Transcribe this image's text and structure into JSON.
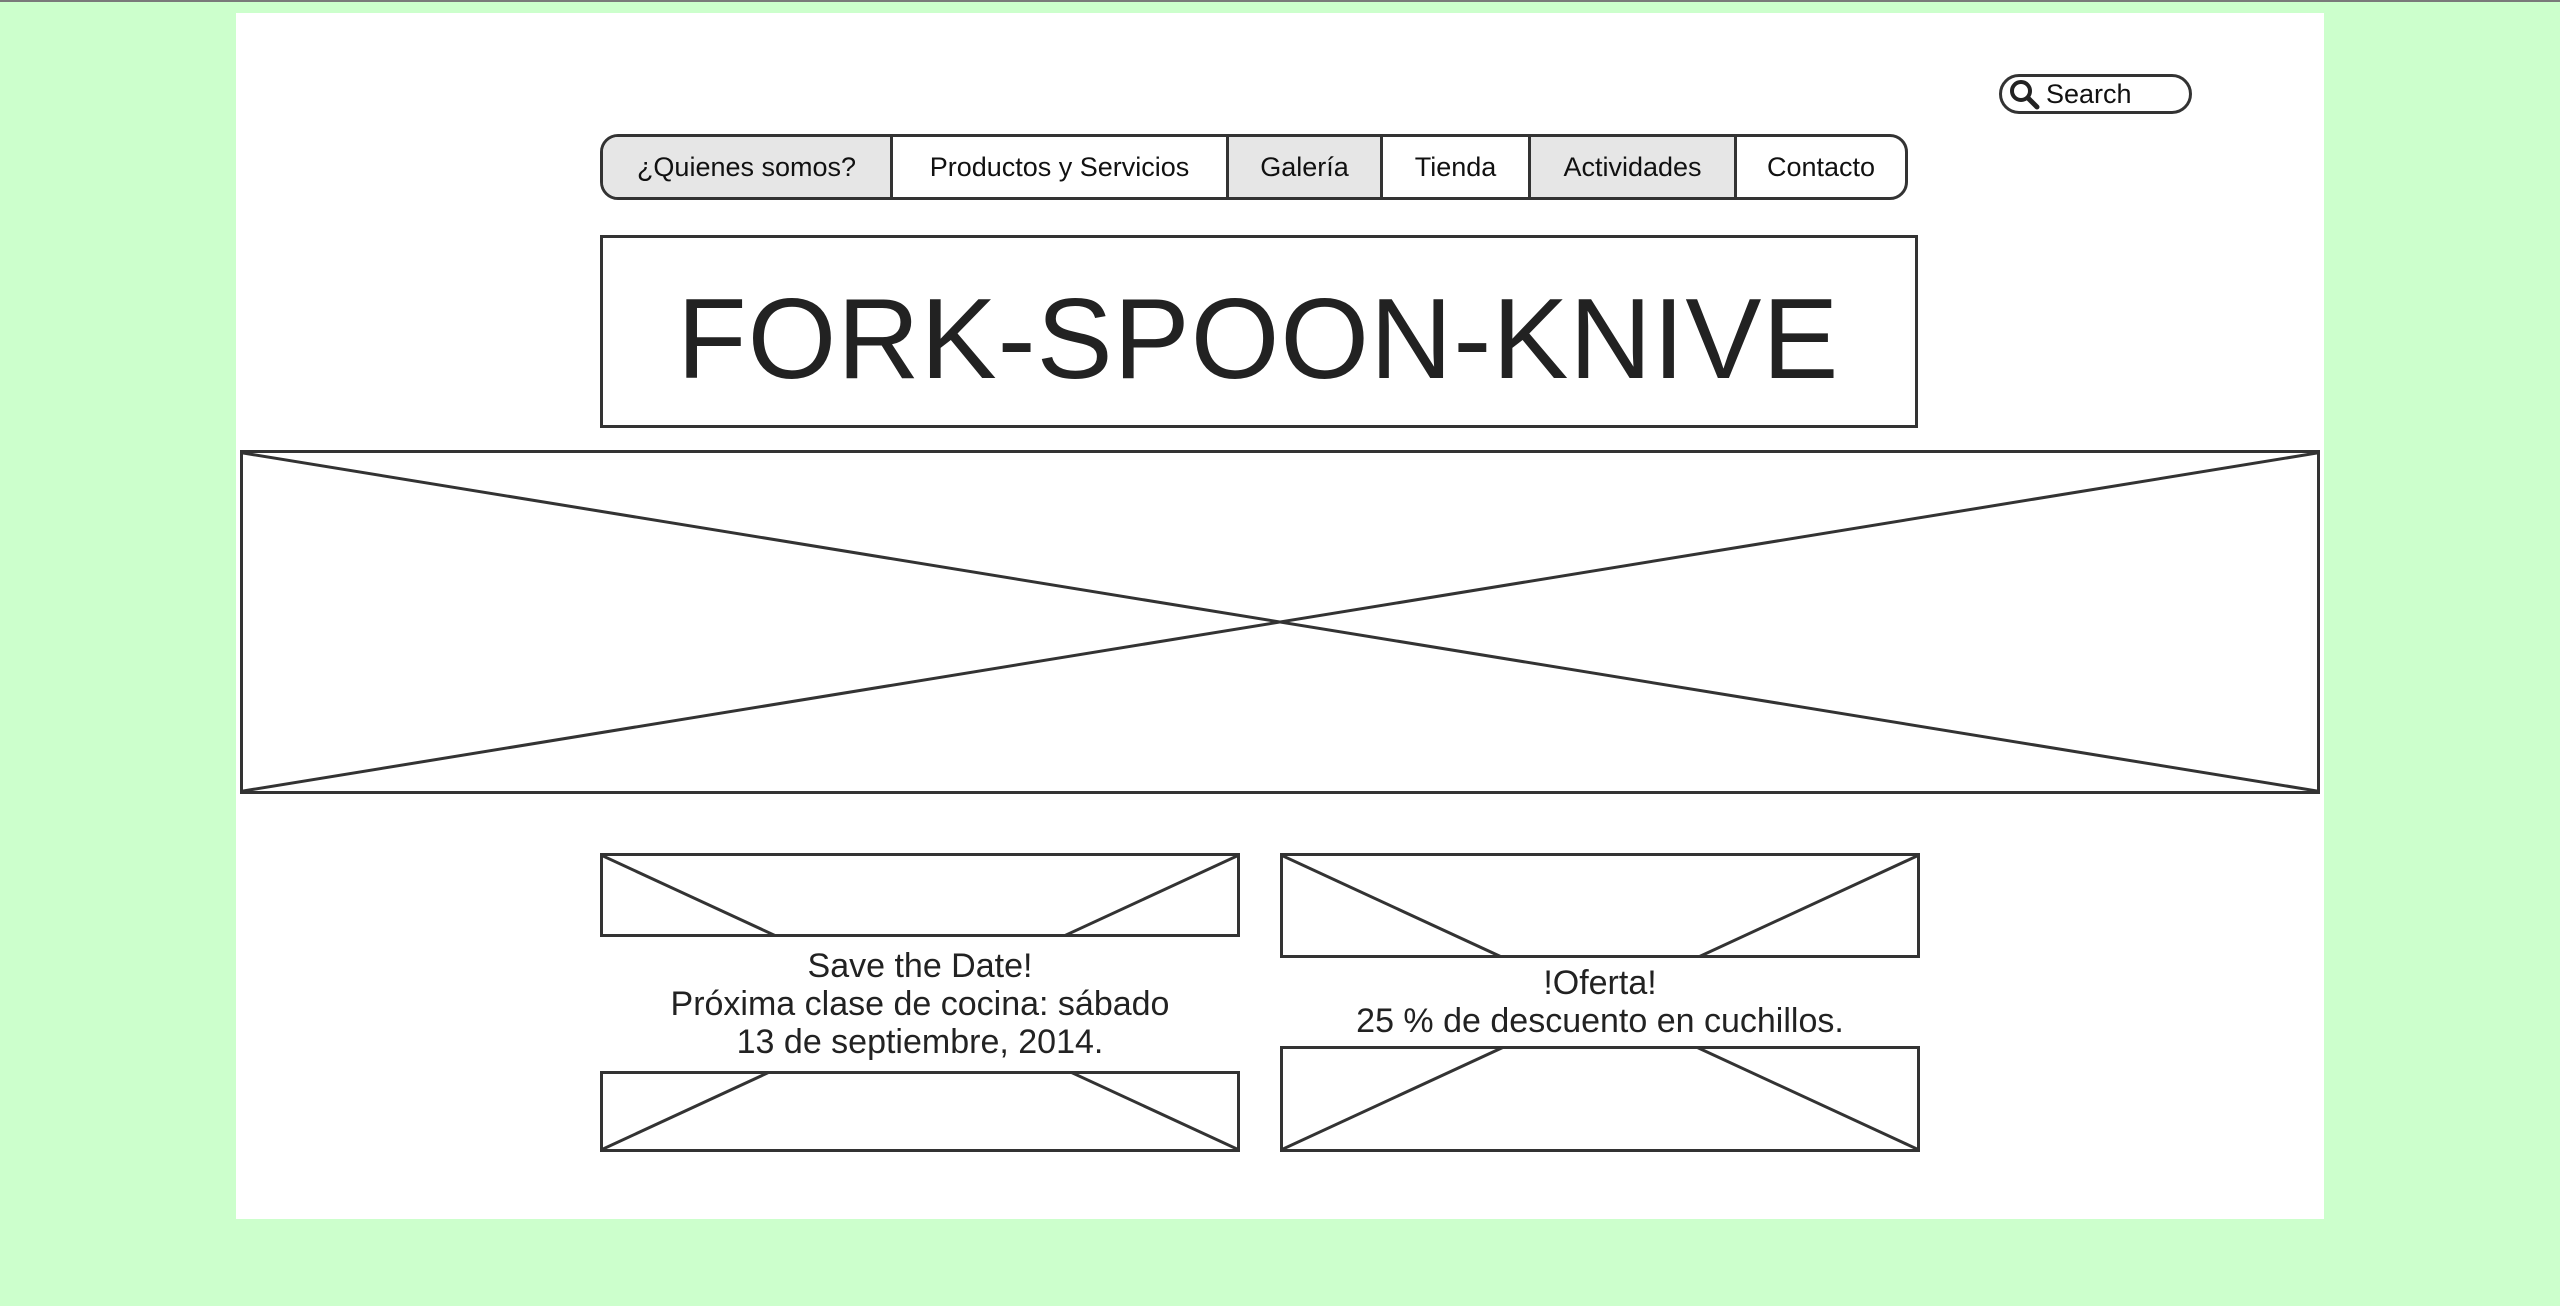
{
  "search": {
    "placeholder": "Search"
  },
  "nav": {
    "tabs": [
      {
        "label": "¿Quienes somos?"
      },
      {
        "label": "Productos y Servicios"
      },
      {
        "label": "Galería"
      },
      {
        "label": "Tienda"
      },
      {
        "label": "Actividades"
      },
      {
        "label": "Contacto"
      }
    ]
  },
  "header": {
    "title": "FORK-SPOON-KNIVE"
  },
  "cards": [
    {
      "lines": [
        "Save the Date!",
        "Próxima clase de cocina: sábado",
        "13 de septiembre, 2014."
      ]
    },
    {
      "lines": [
        "!Oferta!",
        "25 % de descuento en cuchillos."
      ]
    }
  ],
  "colors": {
    "background": "#ccffcc",
    "page": "#ffffff",
    "stroke": "#333333",
    "tab_shade": "#e6e6e6"
  }
}
